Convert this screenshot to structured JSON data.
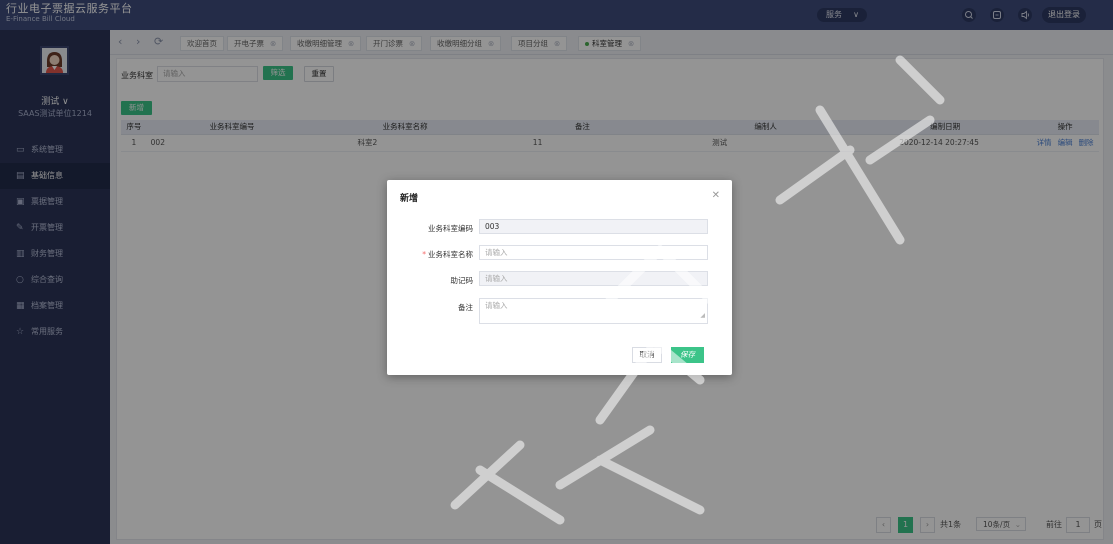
{
  "header": {
    "brand_cn": "行业电子票据云服务平台",
    "brand_en": "E-Finance Bill Cloud",
    "service_dropdown": "服务",
    "logout": "退出登录",
    "icons": [
      "search-icon",
      "message-icon",
      "notification-icon"
    ]
  },
  "user": {
    "name": "测试 ∨",
    "org": "SAAS测试单位1214"
  },
  "sidebar": {
    "items": [
      {
        "label": "系统管理",
        "icon": "monitor-icon"
      },
      {
        "label": "基础信息",
        "icon": "document-icon",
        "active": true
      },
      {
        "label": "票据管理",
        "icon": "ticket-icon"
      },
      {
        "label": "开票管理",
        "icon": "edit-icon"
      },
      {
        "label": "财务管理",
        "icon": "finance-icon"
      },
      {
        "label": "综合查询",
        "icon": "search-icon"
      },
      {
        "label": "档案管理",
        "icon": "grid-icon"
      },
      {
        "label": "常用服务",
        "icon": "star-icon"
      }
    ]
  },
  "tabs": [
    {
      "label": "欢迎首页"
    },
    {
      "label": "开电子票"
    },
    {
      "label": "收缴明细管理"
    },
    {
      "label": "开门诊票"
    },
    {
      "label": "收缴明细分组"
    },
    {
      "label": "项目分组"
    },
    {
      "label": "科室管理",
      "active": true
    }
  ],
  "filter": {
    "label": "业务科室",
    "placeholder": "请输入",
    "search_button": "筛选",
    "reset_button": "重置",
    "add_button": "新增"
  },
  "table": {
    "columns": [
      "序号",
      "业务科室编号",
      "业务科室名称",
      "备注",
      "编制人",
      "编制日期",
      "操作"
    ],
    "rows": [
      {
        "index": "1",
        "code": "002",
        "name": "科室2",
        "remark": "11",
        "creator": "测试",
        "date": "2020-12-14 20:27:45"
      }
    ],
    "actions": [
      "详情",
      "编辑",
      "删除"
    ]
  },
  "pagination": {
    "current": "1",
    "total": "共1条",
    "page_size": "10条/页",
    "goto_label": "前往",
    "goto_value": "1",
    "page_suffix": "页"
  },
  "modal": {
    "title": "新增",
    "fields": {
      "code": {
        "label": "业务科室编码",
        "value": "003"
      },
      "name": {
        "label": "业务科室名称",
        "placeholder": "请输入"
      },
      "mnemonic": {
        "label": "助记码",
        "placeholder": "请输入"
      },
      "remark": {
        "label": "备注",
        "placeholder": "请输入"
      }
    },
    "cancel": "取消",
    "save": "保存"
  },
  "watermark": "所有 禁止盗用",
  "colors": {
    "header": "#3e4d7c",
    "sidebar": "#2b3558",
    "accent_green": "#3cc489",
    "table_header": "#e8edf6"
  }
}
